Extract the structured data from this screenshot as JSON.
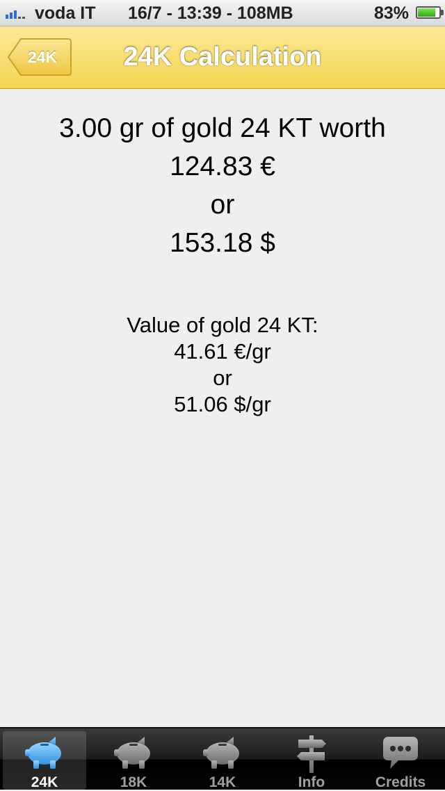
{
  "status_bar": {
    "carrier": "voda IT",
    "center_text": "16/7 - 13:39 - 108MB",
    "battery_percent": "83%",
    "battery_level": 0.83
  },
  "nav_bar": {
    "back_label": "24K",
    "title": "24K Calculation"
  },
  "result": {
    "line1": "3.00 gr of gold 24 KT worth",
    "euro_value": "124.83 €",
    "or": "or",
    "dollar_value": "153.18 $"
  },
  "rate": {
    "heading": "Value of gold 24 KT:",
    "euro_per_gram": "41.61 €/gr",
    "or": "or",
    "dollar_per_gram": "51.06 $/gr"
  },
  "tab_bar": {
    "tabs": [
      {
        "label": "24K",
        "icon": "piggy-bank-icon",
        "active": true
      },
      {
        "label": "18K",
        "icon": "piggy-bank-icon",
        "active": false
      },
      {
        "label": "14K",
        "icon": "piggy-bank-icon",
        "active": false
      },
      {
        "label": "Info",
        "icon": "signpost-icon",
        "active": false
      },
      {
        "label": "Credits",
        "icon": "speech-bubble-icon",
        "active": false
      }
    ]
  },
  "colors": {
    "nav_yellow": "#f4d34f",
    "active_tab_icon": "#5bb8f5",
    "inactive_tab_icon": "#8a8a8a"
  }
}
